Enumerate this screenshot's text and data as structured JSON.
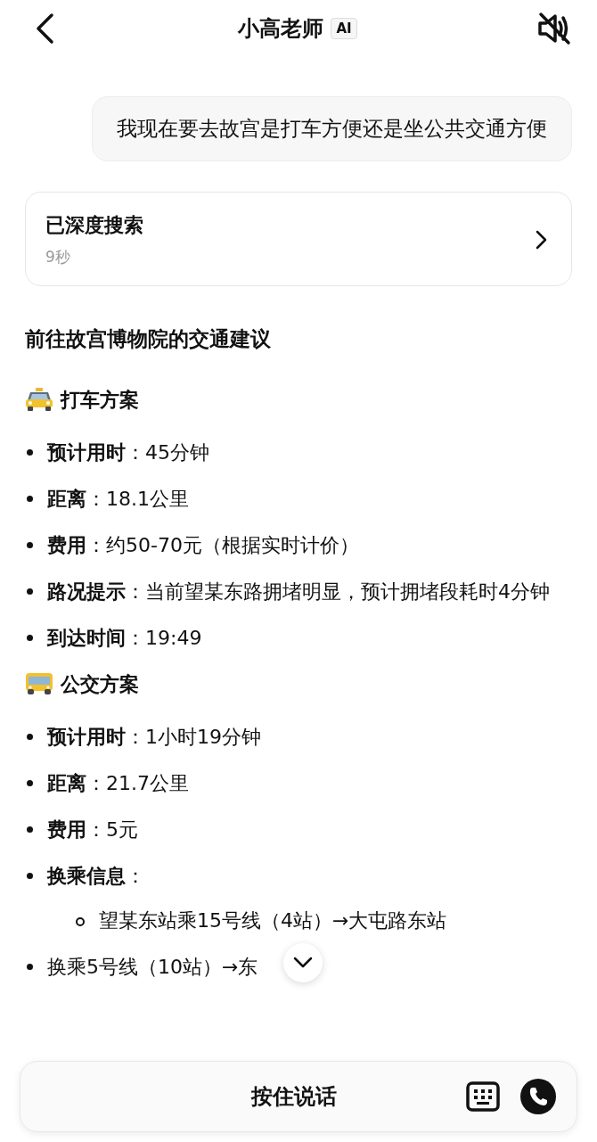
{
  "header": {
    "title": "小高老师",
    "badge": "AI",
    "muted": true
  },
  "user_message": "我现在要去故宫是打车方便还是坐公共交通方便",
  "search_card": {
    "title": "已深度搜索",
    "duration": "9秒"
  },
  "answer": {
    "title": "前往故宫博物院的交通建议",
    "sections": [
      {
        "kind": "taxi",
        "heading": "打车方案",
        "items": [
          {
            "text": "**预计用时**：45分钟"
          },
          {
            "text": "**距离**：18.1公里"
          },
          {
            "text": "**费用**：约50-70元（根据实时计价）"
          },
          {
            "text": "**路况提示**：当前望某东路拥堵明显，预计拥堵段耗时4分钟"
          },
          {
            "text": "**到达时间**：19:49"
          }
        ]
      },
      {
        "kind": "bus",
        "heading": "公交方案",
        "items": [
          {
            "text": "**预计用时**：1小时19分钟"
          },
          {
            "text": "**距离**：21.7公里"
          },
          {
            "text": "**费用**：5元"
          },
          {
            "text": "**换乘信息**：",
            "children": [
              {
                "text": "望某东站乘15号线（4站）→大屯路东站"
              }
            ]
          },
          {
            "text": "换乘5号线（10站）→东"
          }
        ]
      }
    ]
  },
  "input_bar": {
    "label": "按住说话"
  }
}
